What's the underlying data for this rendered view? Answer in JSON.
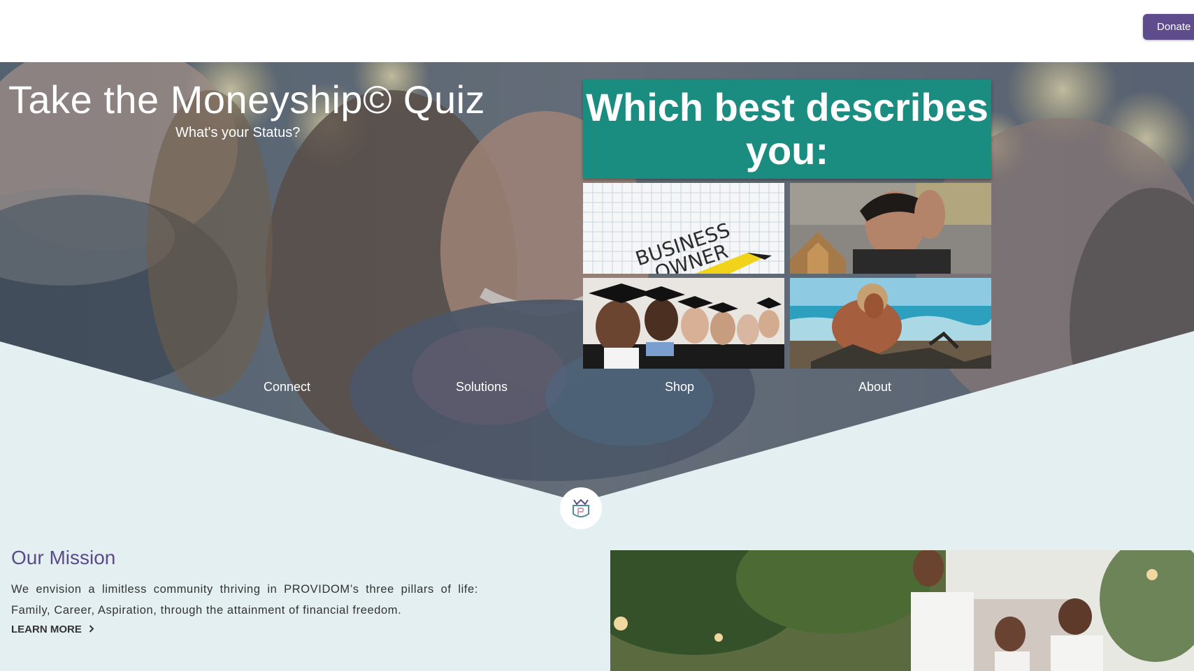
{
  "header": {
    "donate_label": "Donate"
  },
  "hero": {
    "title": "Take the Moneyship© Quiz",
    "subtitle": "What's your Status?",
    "question": "Which best describes you:",
    "options": [
      {
        "label_image_text": "BUSINESS OWNER",
        "icon": "business-owner-image"
      },
      {
        "icon": "stressed-man-image"
      },
      {
        "icon": "graduates-image"
      },
      {
        "icon": "castaway-image"
      }
    ]
  },
  "nav": {
    "items": [
      {
        "label": "Connect"
      },
      {
        "label": "Solutions"
      },
      {
        "label": "Shop"
      },
      {
        "label": "About"
      }
    ]
  },
  "mission": {
    "title": "Our Mission",
    "text": "We envision a limitless community thriving in PROVIDOM’s three pillars of life: Family, Career, Aspiration, through the attainment of financial freedom.",
    "learn_more": "LEARN MORE",
    "chevron_icon": "chevron-right-icon"
  },
  "colors": {
    "brand_purple": "#5f4c8c",
    "quiz_teal": "#1a8c80",
    "page_bg": "#e3eff0"
  }
}
